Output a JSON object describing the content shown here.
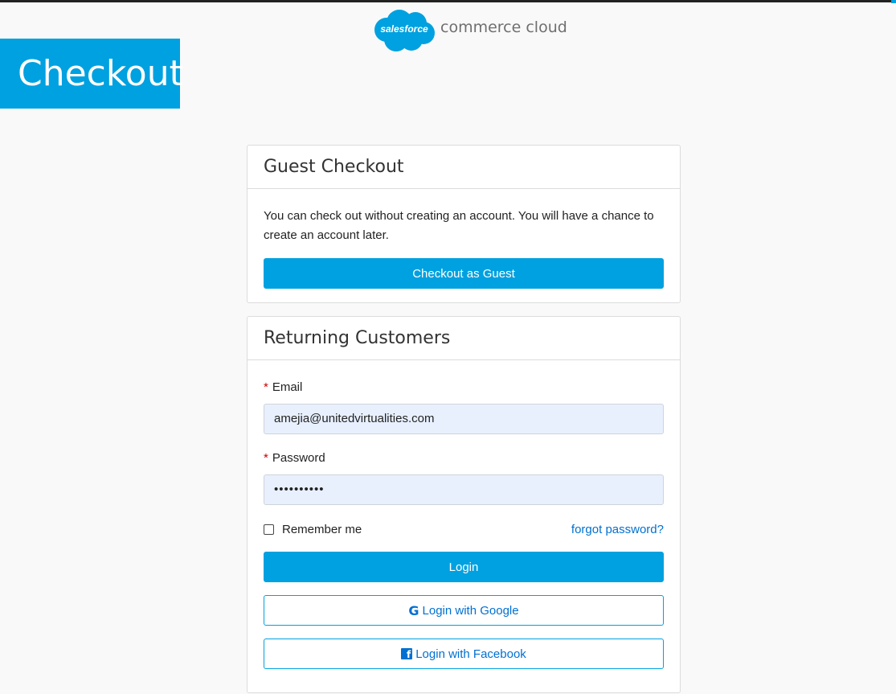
{
  "header": {
    "logo_cloud_text": "salesforce",
    "logo_product_text": "commerce cloud",
    "brand_color": "#00a1e0"
  },
  "banner": {
    "title": "Checkout"
  },
  "guest_checkout": {
    "title": "Guest Checkout",
    "description": "You can check out without creating an account. You will have a chance to create an account later.",
    "button_label": "Checkout as Guest"
  },
  "returning_customers": {
    "title": "Returning Customers",
    "required_marker": "*",
    "email": {
      "label": "Email",
      "value": "amejia@unitedvirtualities.com"
    },
    "password": {
      "label": "Password",
      "value": "••••••••••"
    },
    "remember_me": {
      "label": "Remember me",
      "checked": false
    },
    "forgot_password_label": "forgot password?",
    "login_button_label": "Login",
    "google": {
      "icon": "google-icon",
      "label": "Login with Google"
    },
    "facebook": {
      "icon": "facebook-icon",
      "label": "Login with Facebook"
    }
  }
}
